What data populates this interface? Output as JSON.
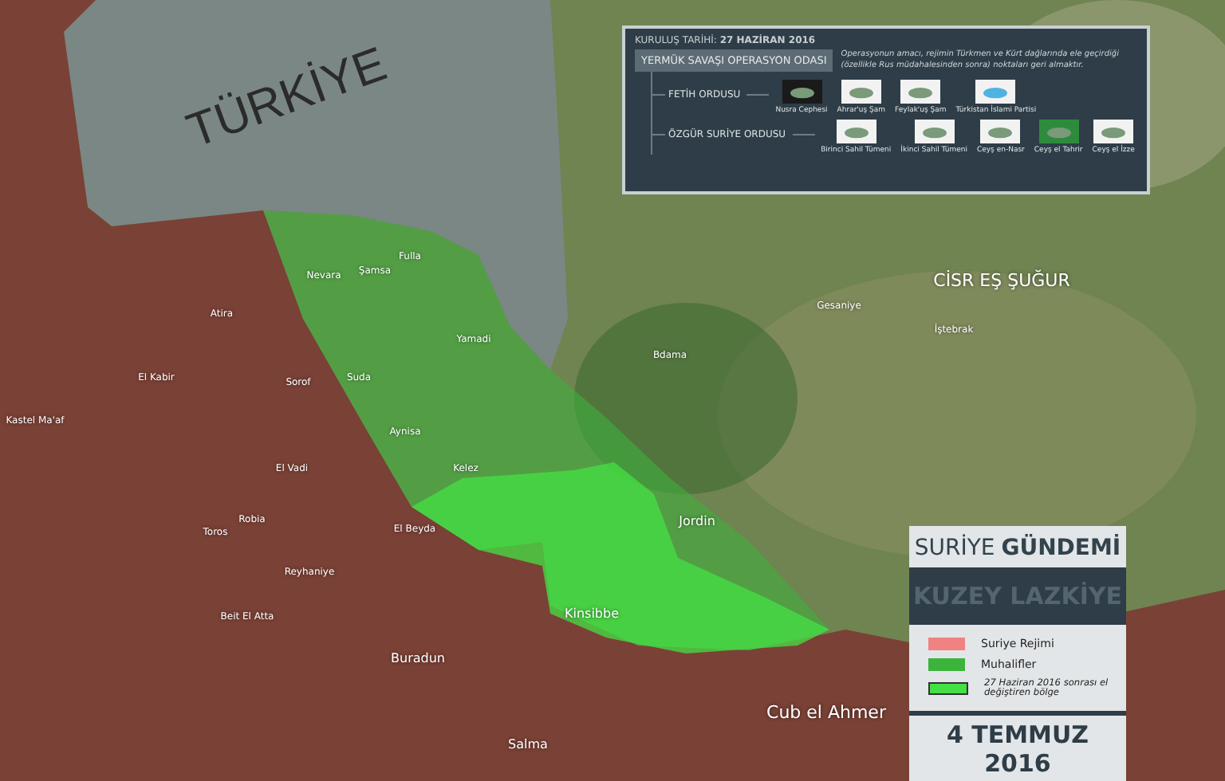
{
  "map": {
    "labels": [
      {
        "text": "TÜRKİYE",
        "kind": "country"
      },
      {
        "text": "CİSR EŞ ŞUĞUR",
        "kind": "city"
      },
      {
        "text": "Cub el Ahmer",
        "kind": "city"
      },
      {
        "text": "Kinsibbe",
        "kind": "town"
      },
      {
        "text": "Jordin",
        "kind": "town"
      },
      {
        "text": "Salma",
        "kind": "town"
      },
      {
        "text": "Buradun",
        "kind": "town"
      },
      {
        "text": "Gesaniye",
        "kind": "village"
      },
      {
        "text": "İştebrak",
        "kind": "village"
      },
      {
        "text": "Bdama",
        "kind": "village"
      },
      {
        "text": "Nevara",
        "kind": "village"
      },
      {
        "text": "Şamsa",
        "kind": "village"
      },
      {
        "text": "Fulla",
        "kind": "village"
      },
      {
        "text": "Atira",
        "kind": "village"
      },
      {
        "text": "Yamadi",
        "kind": "village"
      },
      {
        "text": "Suda",
        "kind": "village"
      },
      {
        "text": "Sorof",
        "kind": "village"
      },
      {
        "text": "El Kabir",
        "kind": "village"
      },
      {
        "text": "Kastel Ma'af",
        "kind": "village"
      },
      {
        "text": "Aynisa",
        "kind": "village"
      },
      {
        "text": "Kelez",
        "kind": "village"
      },
      {
        "text": "El Vadi",
        "kind": "village"
      },
      {
        "text": "Robia",
        "kind": "village"
      },
      {
        "text": "Toros",
        "kind": "village"
      },
      {
        "text": "El Beyda",
        "kind": "village"
      },
      {
        "text": "Reyhaniye",
        "kind": "village"
      },
      {
        "text": "Beit El Atta",
        "kind": "village"
      }
    ]
  },
  "info_box": {
    "founded": "KURULUŞ TARİHİ: **27 HAZİRAN 2016**",
    "operation_room": "YERMÜK SAVAŞI OPERASYON ODASI",
    "description": "Operasyonun amacı, rejimin Türkmen ve Kürt dağlarında ele geçirdiği (özellikle Rus müdahalesinden sonra) noktaları geri almaktır.",
    "groups": [
      {
        "name": "FETİH ORDUSU",
        "factions": [
          "Nusra Cephesi",
          "Ahrar'uş Şam",
          "Feylak'uş Şam",
          "Türkistan İslami Partisi"
        ]
      },
      {
        "name": "ÖZGÜR SURİYE ORDUSU",
        "factions": [
          "Birinci Sahil Tümeni",
          "İkinci Sahil Tümeni",
          "Ceyş en-Nasr",
          "Ceyş el Tahrir",
          "Ceyş el İzze"
        ]
      }
    ]
  },
  "legend": {
    "brand_light": "SURİYE",
    "brand_bold": "GÜNDEMİ",
    "region": "KUZEY LAZKİYE",
    "items": [
      {
        "label": "Suriye Rejimi",
        "color": "#f08282",
        "kind": "area"
      },
      {
        "label": "Muhalifler",
        "color": "#3cb43c",
        "kind": "area"
      },
      {
        "label": "27 Haziran 2016 sonrası el değiştiren bölge",
        "color": "#44e044",
        "kind": "changed"
      }
    ],
    "date": "4 TEMMUZ 2016"
  }
}
